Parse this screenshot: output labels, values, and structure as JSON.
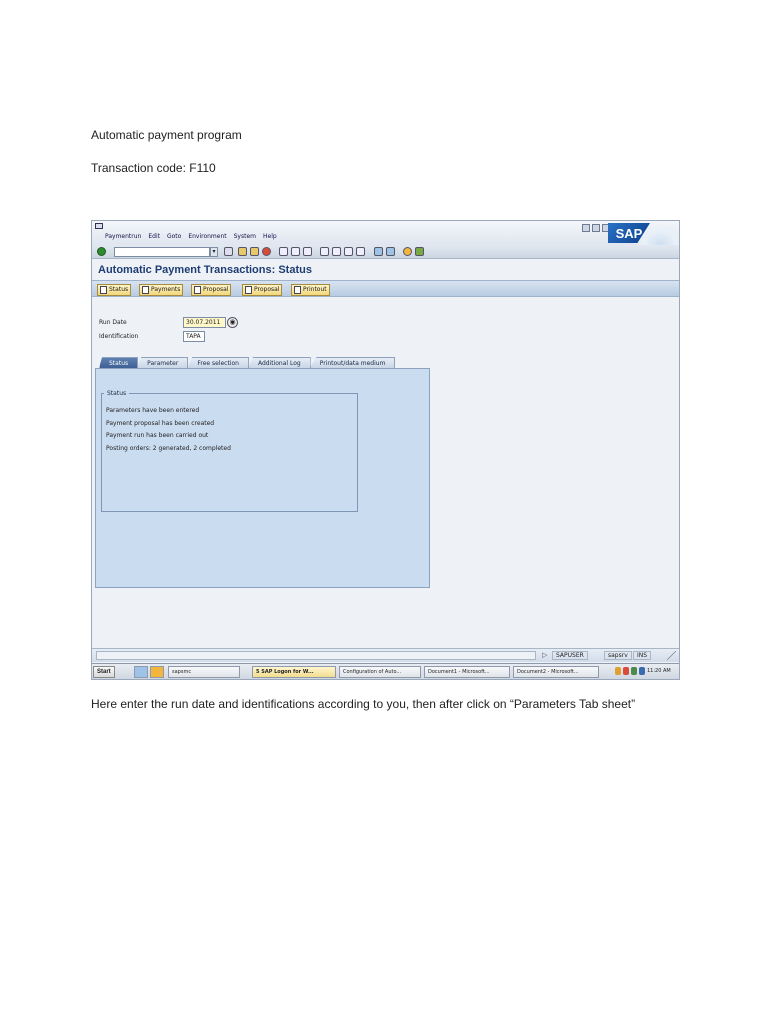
{
  "document": {
    "title": "Automatic payment program",
    "transaction_code": "Transaction code: F110",
    "instruction": "Here enter the run date and identifications according to you, then after click on “Parameters Tab sheet”"
  },
  "sap": {
    "menu": [
      "Paymentrun",
      "Edit",
      "Goto",
      "Environment",
      "System",
      "Help"
    ],
    "logo_text": "SAP",
    "screen_title": "Automatic Payment Transactions: Status",
    "app_toolbar": {
      "status": "Status",
      "payments": "Payments",
      "proposal_edit": "Proposal",
      "proposal": "Proposal",
      "printout": "Printout"
    },
    "fields": {
      "run_date_label": "Run Date",
      "run_date_value": "30.07.2011",
      "identification_label": "Identification",
      "identification_value": "TAPA"
    },
    "tabs": [
      "Status",
      "Parameter",
      "Free selection",
      "Additional Log",
      "Printout/data medium"
    ],
    "status_group": {
      "title": "Status",
      "lines": [
        "Parameters have been entered",
        "Payment proposal has been created",
        "Payment run has been carried out",
        "Posting orders: 2 generated, 2 completed"
      ]
    },
    "statusbar": {
      "user": "SAPUSER",
      "server": "sapsrv",
      "mode": "INS"
    },
    "taskbar": {
      "start": "Start",
      "items": [
        "sapsmc",
        "5 SAP Logon for W...",
        "Configuration of Auto...",
        "Document1 - Microsoft...",
        "Document2 - Microsoft..."
      ],
      "clock": "11:20 AM"
    }
  }
}
